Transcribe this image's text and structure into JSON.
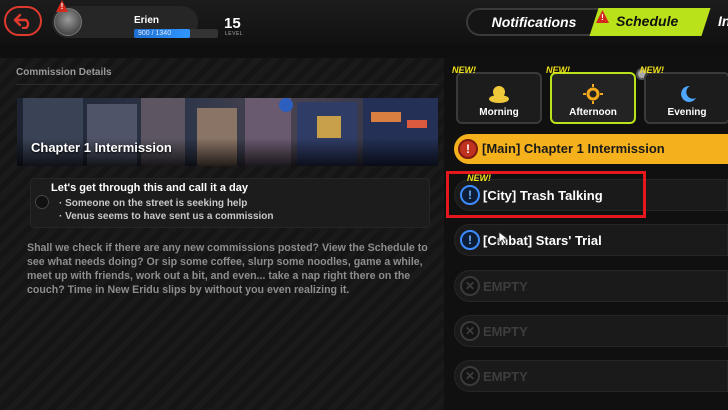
{
  "player": {
    "name": "Erien",
    "xp": "900 / 1340",
    "xp_fraction": 0.67,
    "level": "15",
    "level_label": "LEVEL",
    "alert": "!"
  },
  "tabs": {
    "notifications": "Notifications",
    "schedule": "Schedule",
    "schedule_alert": "!",
    "next": "In"
  },
  "commission": {
    "panel_title": "Commission Details",
    "banner_title": "Chapter 1 Intermission",
    "objective": "Let's get through this and call it a day",
    "sub_items": [
      "· Someone on the street is seeking help",
      "· Venus seems to have sent us a commission"
    ],
    "description": "Shall we check if there are any new commissions posted? View the Schedule to see what needs doing? Or sip some coffee, slurp some noodles, game a while, meet up with friends, work out a bit, and even... take a nap right there on the couch? Time in New Eridu slips by without you even realizing it."
  },
  "time_slots": [
    {
      "label": "Morning",
      "tag": "NEW!",
      "icon": "sun-cloud-icon"
    },
    {
      "label": "Afternoon",
      "tag": "NEW!",
      "icon": "sun-icon",
      "selected": true
    },
    {
      "label": "Evening",
      "tag": "NEW!",
      "icon": "moon-icon"
    }
  ],
  "quests": {
    "main": "[Main] Chapter 1 Intermission",
    "city": "[City] Trash Talking",
    "city_tag": "NEW!",
    "combat": "[Cmbat] Stars' Trial",
    "empty": [
      "EMPTY",
      "EMPTY",
      "EMPTY"
    ]
  },
  "colors": {
    "accent": "#b9e21a",
    "main_quest": "#f5b11c",
    "highlight": "#e6181e",
    "new_tag": "#f2e21a"
  }
}
